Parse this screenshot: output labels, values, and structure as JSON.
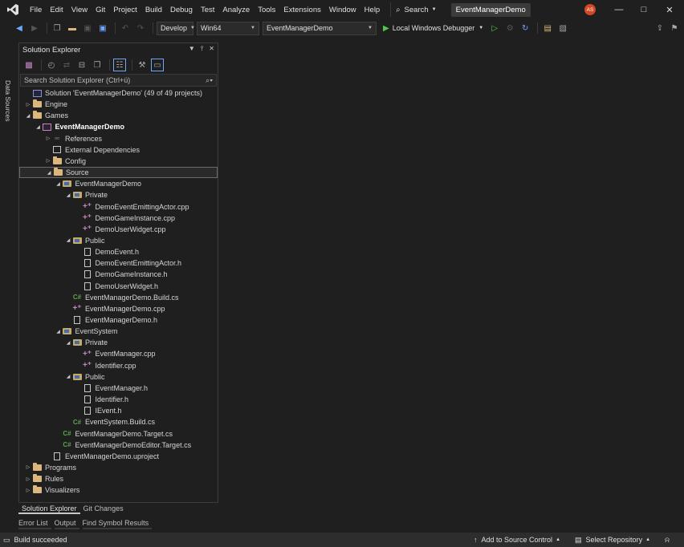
{
  "menu": {
    "items": [
      "File",
      "Edit",
      "View",
      "Git",
      "Project",
      "Build",
      "Debug",
      "Test",
      "Analyze",
      "Tools",
      "Extensions",
      "Window",
      "Help"
    ],
    "search_label": "Search",
    "project_name": "EventManagerDemo",
    "avatar_initials": "AS"
  },
  "toolbar": {
    "configuration": "Develop",
    "platform": "Win64",
    "startup_project": "EventManagerDemo",
    "run_label": "Local Windows Debugger"
  },
  "left_strip": {
    "data_sources": "Data Sources"
  },
  "solution_explorer": {
    "title": "Solution Explorer",
    "search_placeholder": "Search Solution Explorer (Ctrl+ü)",
    "tree": [
      {
        "label": "Solution 'EventManagerDemo' (49 of 49 projects)",
        "icon": "solution-icon",
        "twist": "none",
        "depth": 0
      },
      {
        "label": "Engine",
        "icon": "folder-icon",
        "twist": "collapsed",
        "depth": 0
      },
      {
        "label": "Games",
        "icon": "folder-icon",
        "twist": "expanded",
        "depth": 0
      },
      {
        "label": "EventManagerDemo",
        "icon": "project-icon",
        "twist": "expanded",
        "depth": 1,
        "bold": true
      },
      {
        "label": "References",
        "icon": "references-icon",
        "twist": "collapsed",
        "depth": 2
      },
      {
        "label": "External Dependencies",
        "icon": "dependencies-icon",
        "twist": "none",
        "depth": 2
      },
      {
        "label": "Config",
        "icon": "folder-icon",
        "twist": "collapsed",
        "depth": 2
      },
      {
        "label": "Source",
        "icon": "folder-icon",
        "twist": "expanded",
        "depth": 2,
        "selected": true
      },
      {
        "label": "EventManagerDemo",
        "icon": "filter-folder-icon",
        "twist": "expanded",
        "depth": 3
      },
      {
        "label": "Private",
        "icon": "filter-folder-icon",
        "twist": "expanded",
        "depth": 4
      },
      {
        "label": "DemoEventEmittingActor.cpp",
        "icon": "cpp-file-icon",
        "twist": "none",
        "depth": 5
      },
      {
        "label": "DemoGameInstance.cpp",
        "icon": "cpp-file-icon",
        "twist": "none",
        "depth": 5
      },
      {
        "label": "DemoUserWidget.cpp",
        "icon": "cpp-file-icon",
        "twist": "none",
        "depth": 5
      },
      {
        "label": "Public",
        "icon": "filter-folder-icon",
        "twist": "expanded",
        "depth": 4
      },
      {
        "label": "DemoEvent.h",
        "icon": "header-file-icon",
        "twist": "none",
        "depth": 5
      },
      {
        "label": "DemoEventEmittingActor.h",
        "icon": "header-file-icon",
        "twist": "none",
        "depth": 5
      },
      {
        "label": "DemoGameInstance.h",
        "icon": "header-file-icon",
        "twist": "none",
        "depth": 5
      },
      {
        "label": "DemoUserWidget.h",
        "icon": "header-file-icon",
        "twist": "none",
        "depth": 5
      },
      {
        "label": "EventManagerDemo.Build.cs",
        "icon": "csharp-file-icon",
        "twist": "none",
        "depth": 4
      },
      {
        "label": "EventManagerDemo.cpp",
        "icon": "cpp-file-icon",
        "twist": "none",
        "depth": 4
      },
      {
        "label": "EventManagerDemo.h",
        "icon": "header-file-icon",
        "twist": "none",
        "depth": 4
      },
      {
        "label": "EventSystem",
        "icon": "filter-folder-icon",
        "twist": "expanded",
        "depth": 3
      },
      {
        "label": "Private",
        "icon": "filter-folder-icon",
        "twist": "expanded",
        "depth": 4
      },
      {
        "label": "EventManager.cpp",
        "icon": "cpp-file-icon",
        "twist": "none",
        "depth": 5
      },
      {
        "label": "Identifier.cpp",
        "icon": "cpp-file-icon",
        "twist": "none",
        "depth": 5
      },
      {
        "label": "Public",
        "icon": "filter-folder-icon",
        "twist": "expanded",
        "depth": 4
      },
      {
        "label": "EventManager.h",
        "icon": "header-file-icon",
        "twist": "none",
        "depth": 5
      },
      {
        "label": "Identifier.h",
        "icon": "header-file-icon",
        "twist": "none",
        "depth": 5
      },
      {
        "label": "IEvent.h",
        "icon": "header-file-icon",
        "twist": "none",
        "depth": 5
      },
      {
        "label": "EventSystem.Build.cs",
        "icon": "csharp-file-icon",
        "twist": "none",
        "depth": 4
      },
      {
        "label": "EventManagerDemo.Target.cs",
        "icon": "csharp-file-icon",
        "twist": "none",
        "depth": 3
      },
      {
        "label": "EventManagerDemoEditor.Target.cs",
        "icon": "csharp-file-icon",
        "twist": "none",
        "depth": 3
      },
      {
        "label": "EventManagerDemo.uproject",
        "icon": "header-file-icon",
        "twist": "none",
        "depth": 2
      },
      {
        "label": "Programs",
        "icon": "folder-icon",
        "twist": "collapsed",
        "depth": 0
      },
      {
        "label": "Rules",
        "icon": "folder-icon",
        "twist": "collapsed",
        "depth": 0
      },
      {
        "label": "Visualizers",
        "icon": "folder-icon",
        "twist": "collapsed",
        "depth": 0
      }
    ],
    "tabs": [
      "Solution Explorer",
      "Git Changes"
    ]
  },
  "bottom_tabs": [
    "Error List",
    "Output",
    "Find Symbol Results"
  ],
  "status": {
    "message": "Build succeeded",
    "source_control": "Add to Source Control",
    "repository": "Select Repository"
  }
}
